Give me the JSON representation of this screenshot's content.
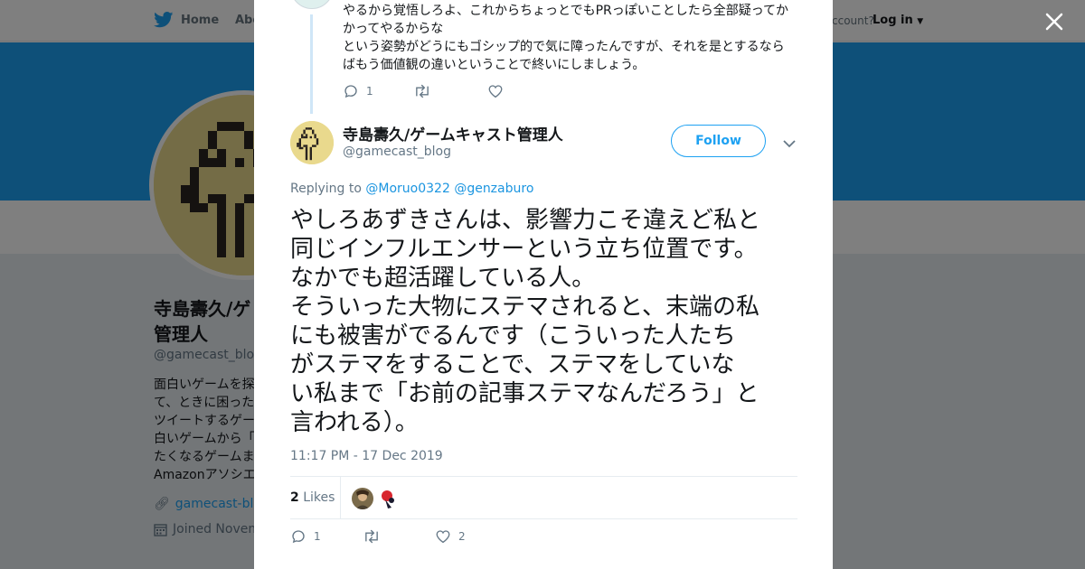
{
  "page": {
    "nav": {
      "home_label": "Home",
      "about_label": "Abo",
      "have_account": "ccount?",
      "login_label": "Log in"
    },
    "profile": {
      "name_line1": "寺島壽久/ゲ",
      "name_line2": "管理人",
      "handle": "@gamecast_blog",
      "bio": "面白いゲームを探\nて、ときに困った\nツイートするゲー\n白いゲームから「\nたくなるゲームま\nAmazonアソシエー",
      "link": "gamecast-blog",
      "joined": "Joined Novem"
    }
  },
  "modal": {
    "previous_tweet": {
      "text_line1": "やるから覚悟しろよ、これからちょっとでもPRっぽいことしたら全部疑ってか",
      "text_line2": "かってやるからな",
      "text_line3": "という姿勢がどうにもゴシップ的で気に障ったんですが、それを是とするなら",
      "text_line4": "ばもう価値観の違いということで終いにしましょう。",
      "reply_count": "1"
    },
    "tweet": {
      "author_name": "寺島壽久/ゲームキャスト管理人",
      "author_handle": "@gamecast_blog",
      "follow_label": "Follow",
      "replying_prefix": "Replying to",
      "replying_user1": "@Moruo0322",
      "replying_user2": "@genzaburo",
      "text": "やしろあずきさんは、影響力こそ違えど私と\n同じインフルエンサーという立ち位置です。\nなかでも超活躍している人。\nそういった大物にステマされると、末端の私\nにも被害がでるんです（こういった人たち\nがステマをすることで、ステマをしていな\nい私まで「お前の記事ステマなんだろう」と\n言われる）。",
      "timestamp": "11:17 PM - 17 Dec 2019",
      "likes_count": "2",
      "likes_label": "Likes",
      "reply_count": "1",
      "like_count": "2"
    }
  },
  "colors": {
    "twitter_blue": "#1da1f2",
    "link_blue": "#1b95e0",
    "text_dark": "#14171a",
    "text_gray": "#657786"
  }
}
